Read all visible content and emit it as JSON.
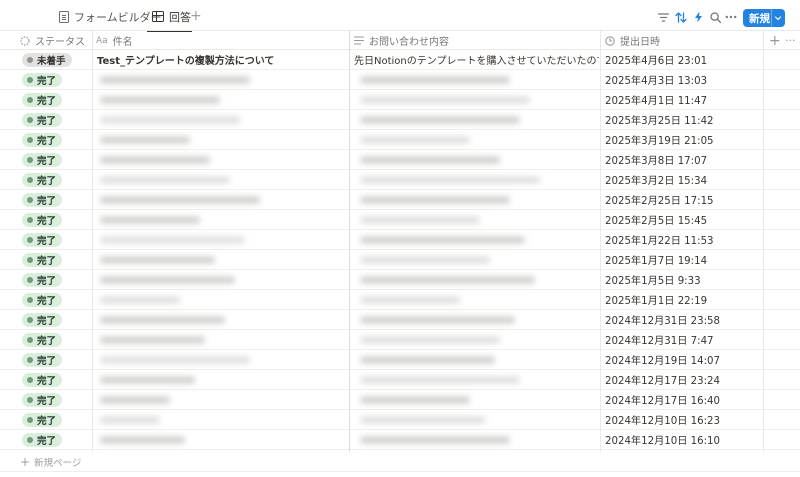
{
  "tabs": [
    {
      "label": "フォームビルダー",
      "icon": "document-icon"
    },
    {
      "label": "回答",
      "icon": "table-icon"
    }
  ],
  "toolbar": {
    "add_view_icon": "plus-icon",
    "filter_icon": "filter-icon",
    "sort_icon": "sort-icon",
    "automation_icon": "lightning-icon",
    "search_icon": "search-icon",
    "more_icon": "more-icon",
    "new_label": "新規",
    "accent": "#2383e2"
  },
  "columns": [
    {
      "label": "ステータス",
      "icon": "status-icon"
    },
    {
      "label": "件名",
      "icon_text": "Aa"
    },
    {
      "label": "お問い合わせ内容",
      "icon": "text-lines-icon"
    },
    {
      "label": "提出日時",
      "icon": "clock-icon"
    }
  ],
  "status_colors": {
    "done_bg": "#dbeddb",
    "done_dot": "#6c9b7d",
    "todo_bg": "#e3e2e0",
    "todo_dot": "#91918e"
  },
  "rows": [
    {
      "status": "未着手",
      "kind": "todo",
      "subject": "Test_テンプレートの複製方法について",
      "content": "先日Notionのテンプレートを購入させていただいたのですが、複",
      "date": "2025年4月6日 23:01"
    },
    {
      "status": "完了",
      "kind": "done",
      "subject": "",
      "content": "",
      "date": "2025年4月3日 13:03"
    },
    {
      "status": "完了",
      "kind": "done",
      "subject": "",
      "content": "",
      "date": "2025年4月1日 11:47"
    },
    {
      "status": "完了",
      "kind": "done",
      "subject": "",
      "content": "",
      "date": "2025年3月25日 11:42"
    },
    {
      "status": "完了",
      "kind": "done",
      "subject": "",
      "content": "",
      "date": "2025年3月19日 21:05"
    },
    {
      "status": "完了",
      "kind": "done",
      "subject": "",
      "content": "",
      "date": "2025年3月8日 17:07"
    },
    {
      "status": "完了",
      "kind": "done",
      "subject": "",
      "content": "",
      "date": "2025年3月2日 15:34"
    },
    {
      "status": "完了",
      "kind": "done",
      "subject": "",
      "content": "",
      "date": "2025年2月25日 17:15"
    },
    {
      "status": "完了",
      "kind": "done",
      "subject": "",
      "content": "",
      "date": "2025年2月5日 15:45"
    },
    {
      "status": "完了",
      "kind": "done",
      "subject": "",
      "content": "",
      "date": "2025年1月22日 11:53"
    },
    {
      "status": "完了",
      "kind": "done",
      "subject": "",
      "content": "",
      "date": "2025年1月7日 19:14"
    },
    {
      "status": "完了",
      "kind": "done",
      "subject": "",
      "content": "",
      "date": "2025年1月5日 9:33"
    },
    {
      "status": "完了",
      "kind": "done",
      "subject": "",
      "content": "",
      "date": "2025年1月1日 22:19"
    },
    {
      "status": "完了",
      "kind": "done",
      "subject": "",
      "content": "",
      "date": "2024年12月31日 23:58"
    },
    {
      "status": "完了",
      "kind": "done",
      "subject": "",
      "content": "",
      "date": "2024年12月31日 7:47"
    },
    {
      "status": "完了",
      "kind": "done",
      "subject": "",
      "content": "",
      "date": "2024年12月19日 14:07"
    },
    {
      "status": "完了",
      "kind": "done",
      "subject": "",
      "content": "",
      "date": "2024年12月17日 23:24"
    },
    {
      "status": "完了",
      "kind": "done",
      "subject": "",
      "content": "",
      "date": "2024年12月17日 16:40"
    },
    {
      "status": "完了",
      "kind": "done",
      "subject": "",
      "content": "",
      "date": "2024年12月10日 16:23"
    },
    {
      "status": "完了",
      "kind": "done",
      "subject": "",
      "content": "",
      "date": "2024年12月10日 16:10"
    }
  ],
  "footer": {
    "new_page_label": "新規ページ"
  }
}
